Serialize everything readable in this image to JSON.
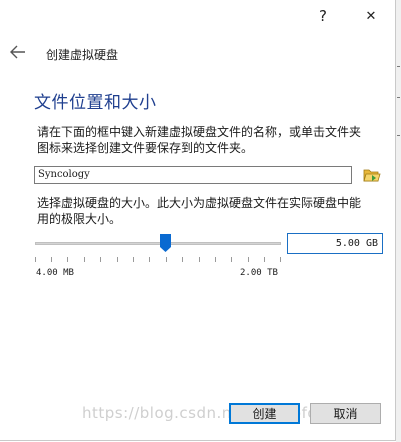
{
  "titlebar": {
    "help_label": "?",
    "close_label": "✕"
  },
  "header": {
    "title": "创建虚拟硬盘"
  },
  "section": {
    "title": "文件位置和大小"
  },
  "location": {
    "description": "请在下面的框中键入新建虚拟硬盘文件的名称，或单击文件夹图标来选择创建文件要保存到的文件夹。",
    "filename": "Syncology"
  },
  "size": {
    "description": "选择虚拟硬盘的大小。此大小为虚拟硬盘文件在实际硬盘中能用的极限大小。",
    "value": "5.00 GB",
    "slider_fraction": 0.53,
    "min_label": "4.00 MB",
    "max_label": "2.00 TB"
  },
  "buttons": {
    "create": "创建",
    "cancel": "取消"
  },
  "watermark": "https://blog.csdn.net/fishaofong",
  "colors": {
    "accent": "#0078d7",
    "section_title": "#1f3f8f"
  },
  "icons": {
    "back": "arrow-left-icon",
    "folder": "folder-open-icon",
    "close": "close-icon",
    "help": "help-icon"
  }
}
